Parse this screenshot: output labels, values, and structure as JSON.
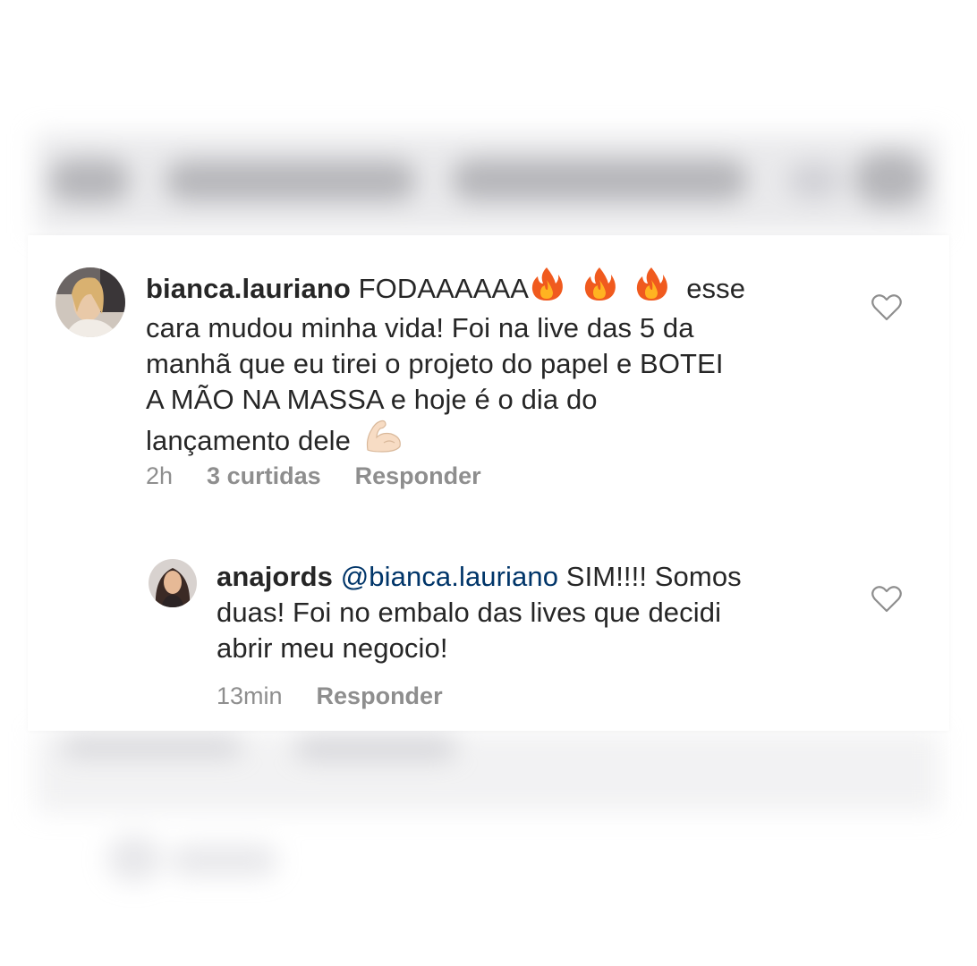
{
  "comments": [
    {
      "username": "bianca.lauriano",
      "text_first": "FODAAAAAA",
      "emoji_fire": "fire-emoji",
      "text_rest_line1": "esse",
      "text_line2": "cara mudou minha vida! Foi na live das 5 da",
      "text_line3": "manhã que eu tirei o projeto do papel e BOTEI",
      "text_line4": "A MÃO NA MASSA e hoje é o dia do",
      "text_line5": "lançamento dele",
      "emoji_end": "flexed-biceps-emoji",
      "time": "2h",
      "likes": "3 curtidas",
      "reply_label": "Responder"
    },
    {
      "username": "anajords",
      "mention": "@bianca.lauriano",
      "text_line1": "SIM!!!! Somos",
      "text_line2": "duas! Foi no embalo das lives que decidi",
      "text_line3": "abrir meu negocio!",
      "time": "13min",
      "reply_label": "Responder"
    }
  ],
  "colors": {
    "text": "#262626",
    "meta": "#8e8e8e",
    "mention": "#003569",
    "heart_stroke": "#8e8e8e"
  }
}
